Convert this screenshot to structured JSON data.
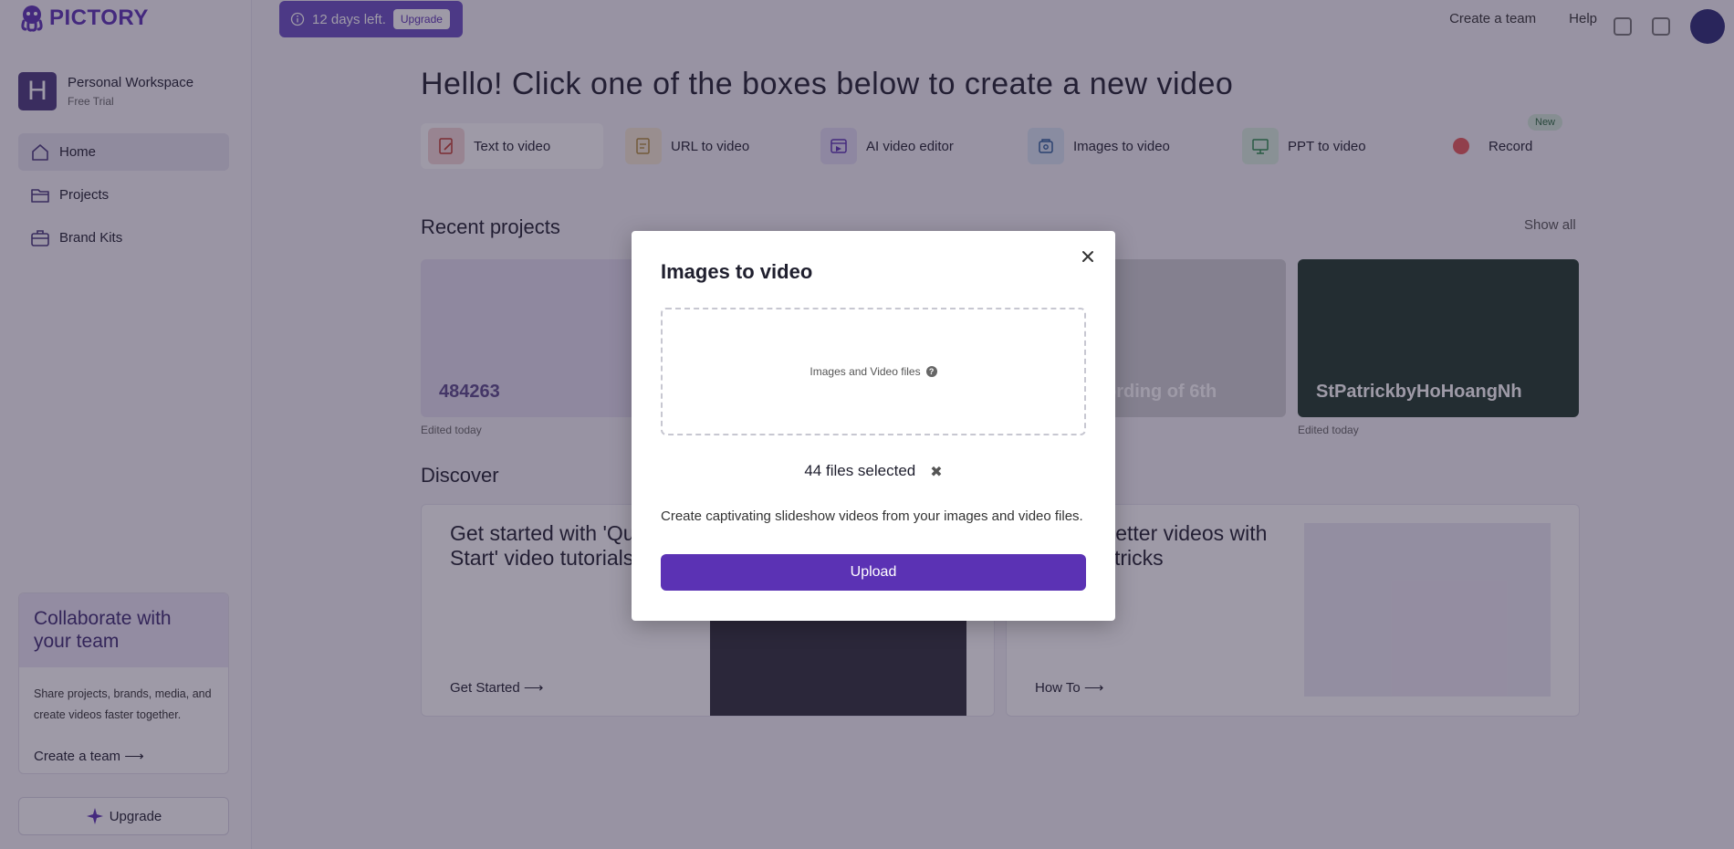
{
  "brand": {
    "name": "PICTORY",
    "color": "#5b32b4"
  },
  "workspace": {
    "initial": "H",
    "name": "Personal Workspace",
    "plan": "Free Trial"
  },
  "sidebar": {
    "items": [
      {
        "label": "Home",
        "icon": "home-icon",
        "active": true
      },
      {
        "label": "Projects",
        "icon": "folder-icon",
        "active": false
      },
      {
        "label": "Brand Kits",
        "icon": "briefcase-icon",
        "active": false
      }
    ],
    "collab": {
      "title": "Collaborate with your team",
      "body": "Share projects, brands, media, and create videos faster together.",
      "link": "Create a team"
    },
    "upgrade_label": "Upgrade"
  },
  "trial": {
    "text": "12 days left.",
    "button": "Upgrade"
  },
  "topbar": {
    "create_team": "Create a team",
    "help": "Help"
  },
  "main": {
    "hello": "Hello! Click one of the boxes below to create a new video",
    "creators": [
      {
        "label": "Text to video",
        "icon": "text-doc-icon",
        "color": "#f5d8d8"
      },
      {
        "label": "URL to video",
        "icon": "link-doc-icon",
        "color": "#f6ead3"
      },
      {
        "label": "AI video editor",
        "icon": "video-edit-icon",
        "color": "#e2ddf5"
      },
      {
        "label": "Images to video",
        "icon": "image-stack-icon",
        "color": "#d9e6f5"
      },
      {
        "label": "PPT to video",
        "icon": "presentation-icon",
        "color": "#d9eedf"
      },
      {
        "label": "Record",
        "icon": "record-icon",
        "color": "#f6dede"
      }
    ],
    "new_badge": "New",
    "recent_title": "Recent projects",
    "show_all": "Show all",
    "projects": [
      {
        "title": "484263",
        "edited": "Edited today"
      },
      {
        "title": "",
        "edited": ""
      },
      {
        "title": "ording of 6th",
        "edited": ""
      },
      {
        "title": "StPatrickbyHoHoangNh",
        "edited": "Edited today"
      }
    ],
    "discover_title": "Discover",
    "discover": [
      {
        "title": "Get started with 'Quick Start' video tutorials",
        "link": "Get Started"
      },
      {
        "title": "Create better videos with tips and tricks",
        "link": "How To"
      }
    ]
  },
  "modal": {
    "title": "Images to video",
    "dropzone_label": "Images and Video files",
    "files_selected": "44 files selected",
    "description": "Create captivating slideshow videos from your images and video files.",
    "upload_label": "Upload"
  }
}
